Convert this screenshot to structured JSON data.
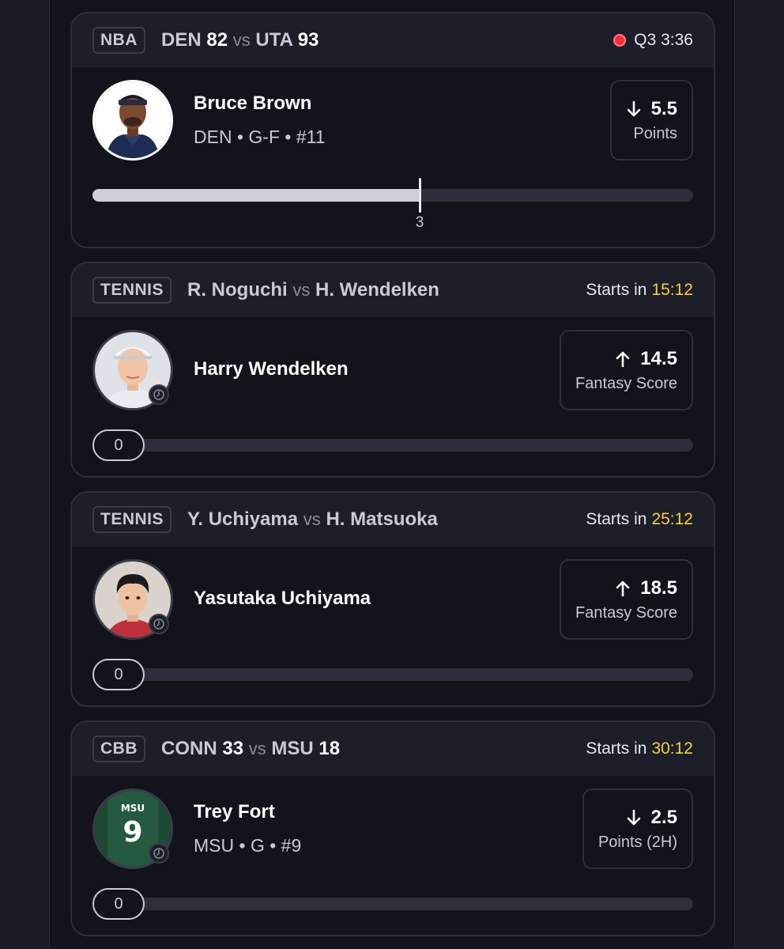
{
  "cards": [
    {
      "league": "NBA",
      "team_a": "DEN",
      "score_a": "82",
      "vs": "vs",
      "team_b": "UTA",
      "score_b": "93",
      "status": "Q3 3:36",
      "player_name": "Bruce Brown",
      "player_info": "DEN • G-F • #11",
      "direction": "down",
      "line": "5.5",
      "stat": "Points",
      "current": "3",
      "progress_fraction": 0.545
    },
    {
      "league": "TENNIS",
      "team_a": "R. Noguchi",
      "vs": "vs",
      "team_b": "H. Wendelken",
      "status_prefix": "Starts in",
      "countdown": "15:12",
      "player_name": "Harry Wendelken",
      "direction": "up",
      "line": "14.5",
      "stat": "Fantasy Score",
      "current": "0"
    },
    {
      "league": "TENNIS",
      "team_a": "Y. Uchiyama",
      "vs": "vs",
      "team_b": "H. Matsuoka",
      "status_prefix": "Starts in",
      "countdown": "25:12",
      "player_name": "Yasutaka Uchiyama",
      "direction": "up",
      "line": "18.5",
      "stat": "Fantasy Score",
      "current": "0"
    },
    {
      "league": "CBB",
      "team_a": "CONN",
      "score_a": "33",
      "vs": "vs",
      "team_b": "MSU",
      "score_b": "18",
      "status_prefix": "Starts in",
      "countdown": "30:12",
      "player_name": "Trey Fort",
      "player_info": "MSU • G • #9",
      "jersey_text": "MSU",
      "jersey_number": "9",
      "direction": "down",
      "line": "2.5",
      "stat": "Points (2H)",
      "current": "0"
    }
  ],
  "icons": {
    "live": "live-dot-icon",
    "clock": "clock-icon",
    "down": "arrow-down-icon",
    "up": "arrow-up-icon"
  },
  "colors": {
    "live": "#ff2a3a",
    "countdown": "#f5d33a",
    "fill": "#cfd0d6"
  }
}
